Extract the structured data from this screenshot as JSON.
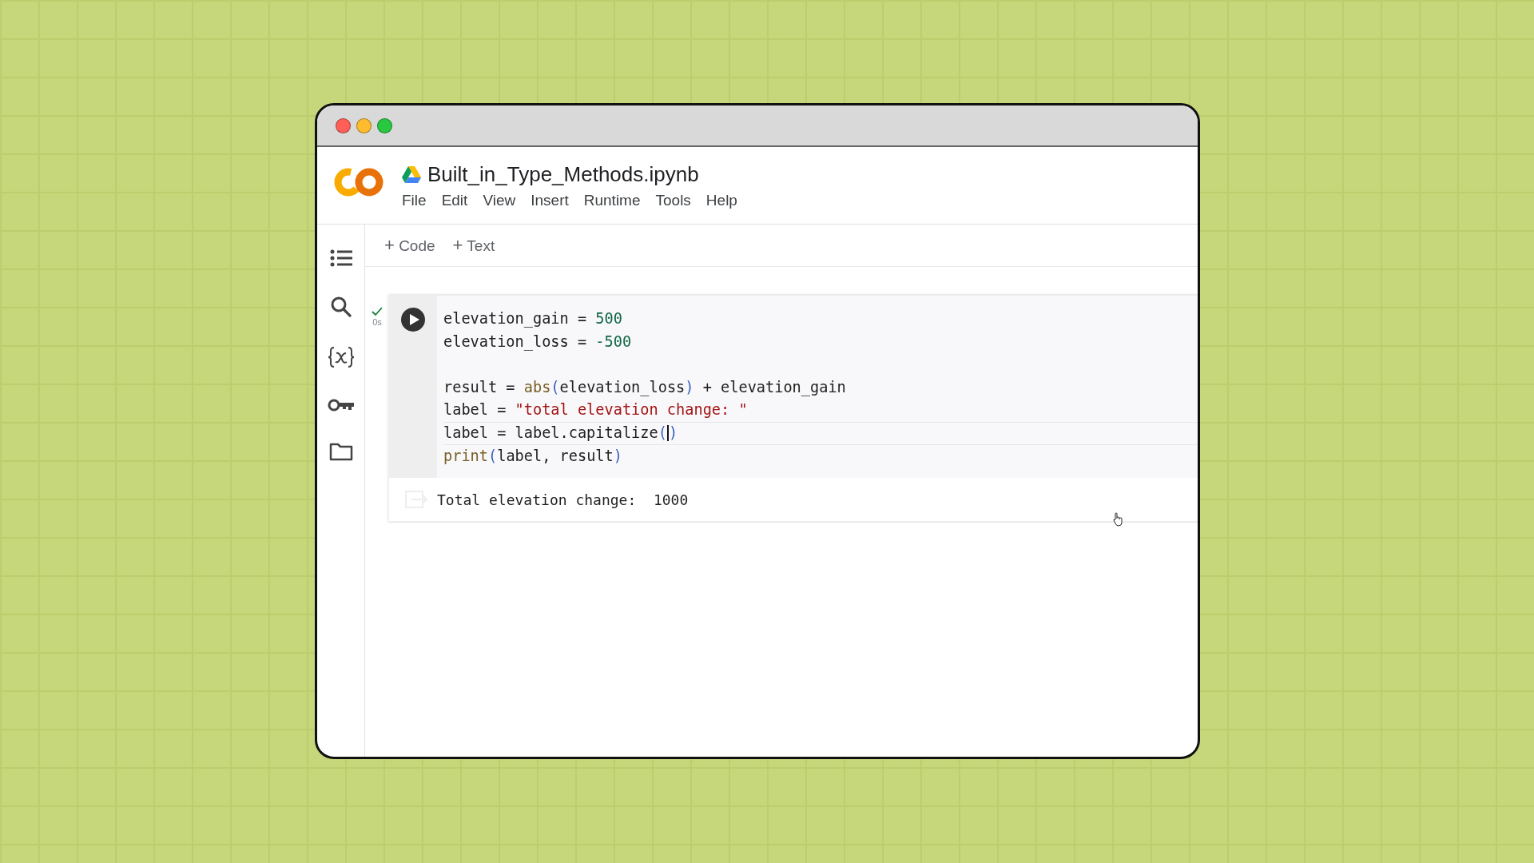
{
  "window": {
    "traffic_lights": [
      {
        "color": "#ff5f57"
      },
      {
        "color": "#febc2e"
      },
      {
        "color": "#28c840"
      }
    ]
  },
  "notebook": {
    "title": "Built_in_Type_Methods.ipynb"
  },
  "menu": [
    "File",
    "Edit",
    "View",
    "Insert",
    "Runtime",
    "Tools",
    "Help"
  ],
  "toolbar": [
    {
      "plus": "+",
      "label": "Code"
    },
    {
      "plus": "+",
      "label": "Text"
    }
  ],
  "sidebar": {
    "items": [
      {
        "kind": "toc"
      },
      {
        "kind": "search"
      },
      {
        "kind": "variables"
      },
      {
        "kind": "key"
      },
      {
        "kind": "folder"
      }
    ]
  },
  "cell": {
    "status": {
      "done": true,
      "time": "0s"
    },
    "lines": [
      {
        "active": false,
        "tokens": [
          {
            "kind": "plain",
            "text": "elevation_gain = "
          },
          {
            "kind": "number",
            "text": "500"
          }
        ]
      },
      {
        "active": false,
        "tokens": [
          {
            "kind": "plain",
            "text": "elevation_loss = "
          },
          {
            "kind": "number",
            "text": "-500"
          }
        ]
      },
      {
        "active": false
      },
      {
        "active": false,
        "tokens": [
          {
            "kind": "plain",
            "text": "result = "
          },
          {
            "kind": "builtin",
            "text": "abs"
          },
          {
            "kind": "paren",
            "text": "("
          },
          {
            "kind": "plain",
            "text": "elevation_loss"
          },
          {
            "kind": "paren",
            "text": ")"
          },
          {
            "kind": "plain",
            "text": " + elevation_gain"
          }
        ]
      },
      {
        "active": false,
        "tokens": [
          {
            "kind": "plain",
            "text": "label = "
          },
          {
            "kind": "string",
            "text": "\"total elevation change: \""
          }
        ]
      },
      {
        "active": true,
        "tokens": [
          {
            "kind": "plain",
            "text": "label = label.capitalize"
          },
          {
            "kind": "paren",
            "text": "(",
            "caret": true
          },
          {
            "kind": "paren",
            "text": ")"
          }
        ]
      },
      {
        "active": false,
        "tokens": [
          {
            "kind": "builtin",
            "text": "print"
          },
          {
            "kind": "paren",
            "text": "("
          },
          {
            "kind": "plain",
            "text": "label, result"
          },
          {
            "kind": "paren",
            "text": ")"
          }
        ]
      }
    ],
    "output": "Total elevation change:  1000"
  }
}
